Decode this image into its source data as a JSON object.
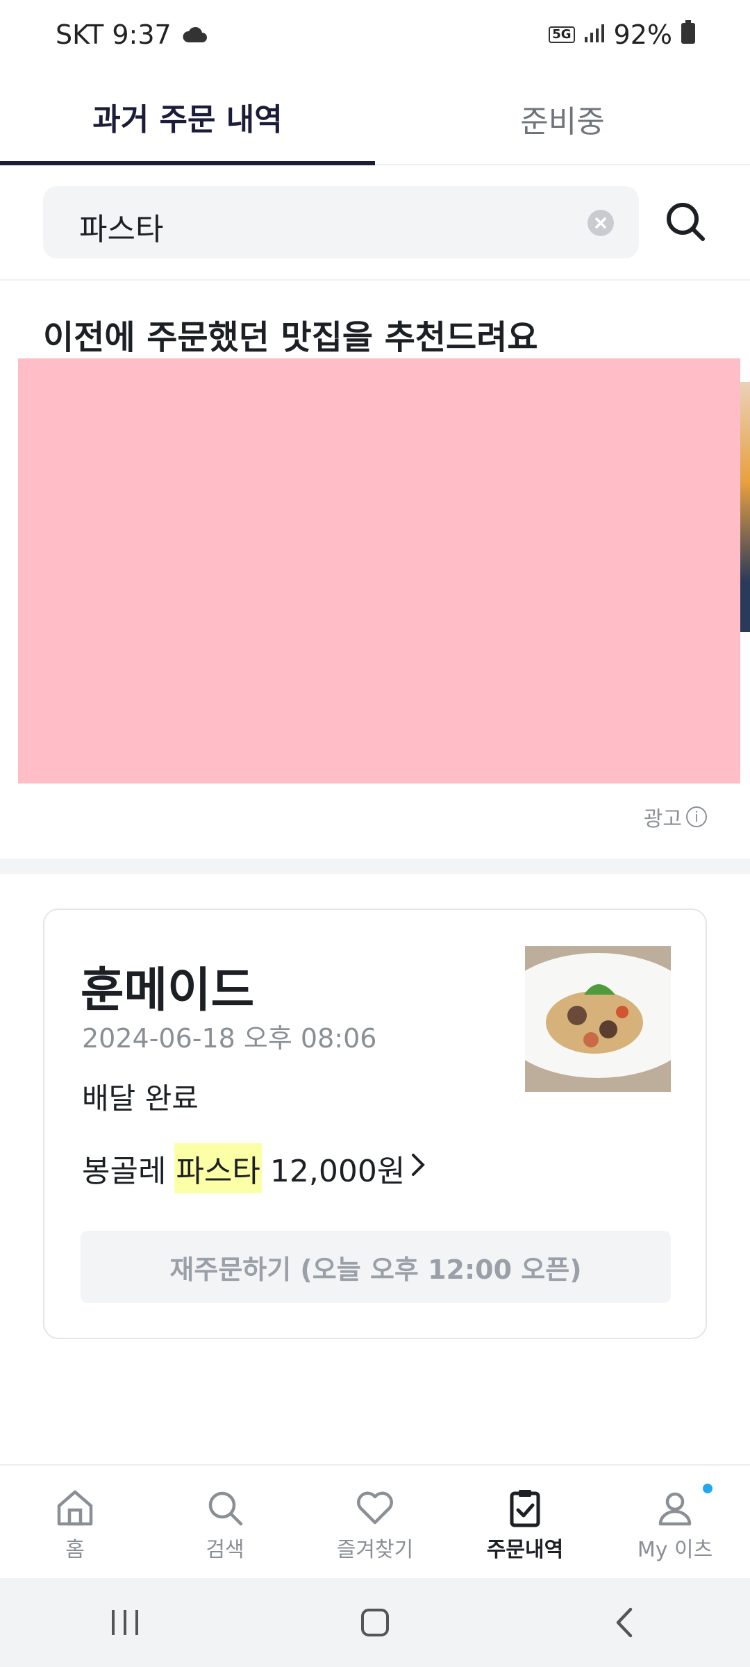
{
  "status_bar": {
    "carrier_time": "SKT 9:37",
    "network": "5G",
    "battery": "92%"
  },
  "tabs": [
    {
      "label": "과거 주문 내역",
      "active": true
    },
    {
      "label": "준비중",
      "active": false
    }
  ],
  "search": {
    "query": "파스타"
  },
  "recommendation": {
    "title": "이전에 주문했던 맛집을 추천드려요",
    "ad_label": "광고"
  },
  "order": {
    "store_name": "훈메이드",
    "datetime": "2024-06-18 오후 08:06",
    "status": "배달 완료",
    "item_prefix": "봉골레",
    "item_highlight": "파스타",
    "item_price": "12,000원",
    "reorder_label": "재주문하기 (오늘 오후 12:00 오픈)"
  },
  "bottom_nav": [
    {
      "label": "홈",
      "icon": "home-icon"
    },
    {
      "label": "검색",
      "icon": "search-icon"
    },
    {
      "label": "즐겨찾기",
      "icon": "heart-icon"
    },
    {
      "label": "주문내역",
      "icon": "clipboard-check-icon",
      "active": true
    },
    {
      "label": "My 이츠",
      "icon": "user-icon",
      "notification_dot": true
    }
  ],
  "colors": {
    "accent": "#1a1c3a",
    "highlight": "#fbffa6",
    "ad_placeholder": "#ffbdc8",
    "notification": "#22a8ee"
  }
}
